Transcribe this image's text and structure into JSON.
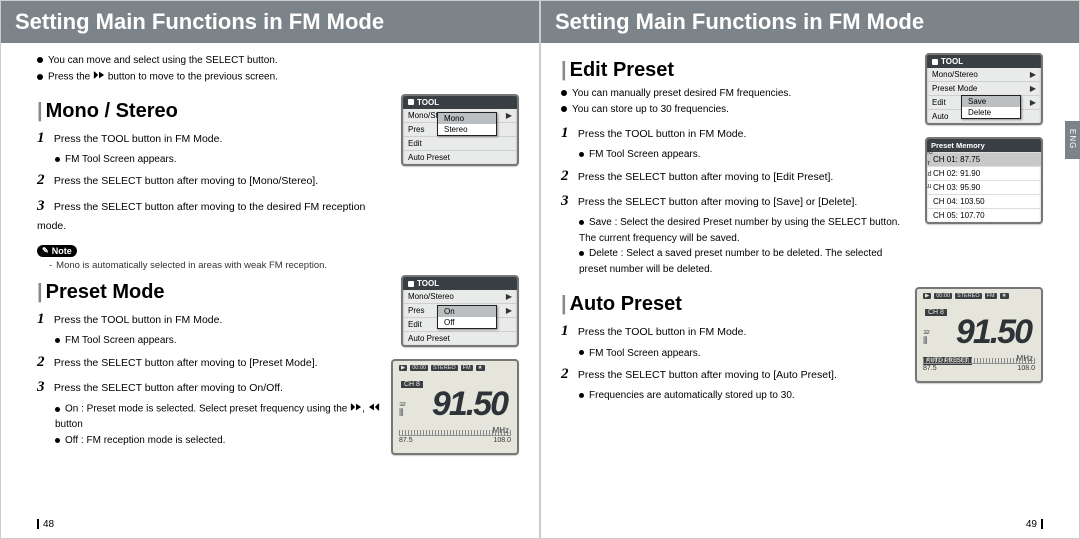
{
  "header": {
    "title_left": "Setting Main Functions in FM Mode",
    "title_right": "Setting Main Functions in FM Mode"
  },
  "page_numbers": {
    "left": "48",
    "right": "49"
  },
  "lang_tab": "ENG",
  "left_intro": {
    "l1": "You can move and select using the SELECT button.",
    "l2a": "Press the ",
    "l2b": " button to move to the previous screen."
  },
  "mono": {
    "heading": "Mono / Stereo",
    "s1": "Press the TOOL button in FM Mode.",
    "s1sub": "FM Tool Screen appears.",
    "s2": "Press the SELECT button after moving to [Mono/Stereo].",
    "s3": "Press the SELECT button after moving to the desired FM reception mode.",
    "note_label": "Note",
    "note": "Mono is automatically selected in areas with weak FM reception."
  },
  "preset": {
    "heading": "Preset Mode",
    "s1": "Press the TOOL button in FM Mode.",
    "s1sub": "FM Tool Screen appears.",
    "s2": "Press the SELECT button after moving to [Preset Mode].",
    "s3": "Press the SELECT button after moving to On/Off.",
    "s3a_pre": "On : Preset mode is selected. Select preset frequency using the ",
    "s3a_post": " button",
    "s3b": "Off : FM reception mode is selected."
  },
  "edit": {
    "heading": "Edit Preset",
    "intro1": "You can manually preset desired FM frequencies.",
    "intro2": "You can store up to 30 frequencies.",
    "s1": "Press the TOOL button in FM Mode.",
    "s1sub": "FM Tool Screen appears.",
    "s2": "Press the SELECT button after moving to [Edit Preset].",
    "s3": "Press the SELECT button after moving to [Save] or [Delete].",
    "s3a": "Save : Select the desired Preset number by using the SELECT button. The current frequency will be saved.",
    "s3b": "Delete : Select a saved preset number to be deleted. The selected preset number will be deleted."
  },
  "auto": {
    "heading": "Auto Preset",
    "s1": "Press the TOOL button in FM Mode.",
    "s1sub": "FM Tool Screen appears.",
    "s2": "Press the SELECT button after moving to [Auto Preset].",
    "s2sub": "Frequencies are automatically stored up to 30."
  },
  "fig": {
    "tool": "TOOL",
    "items": {
      "ms": "Mono/Stereo",
      "pm": "Preset Mode",
      "ep": "Edit Preset",
      "ap": "Auto Preset"
    },
    "mono_sub": {
      "mono": "Mono",
      "stereo": "Stereo"
    },
    "preset_sub": {
      "on": "On",
      "off": "Off"
    },
    "edit_sub": {
      "save": "Save",
      "delete": "Delete"
    },
    "preset_mem_head": "Preset Memory",
    "preset_mem": {
      "r1": "CH 01: 87.75",
      "r2": "CH 02: 91.90",
      "r3": "CH 03: 95.90",
      "r4": "CH 04: 103.50",
      "r5": "CH 05: 107.70"
    },
    "lcd": {
      "time": "00:00",
      "stereo": "STEREO",
      "fm": "FM",
      "ch": "CH  8",
      "freq": "91.50",
      "mhz": "MHz",
      "lo": "87.5",
      "hi": "108.0",
      "sig": "⦀₃₂",
      "auto": "AUTO PRESET"
    }
  }
}
